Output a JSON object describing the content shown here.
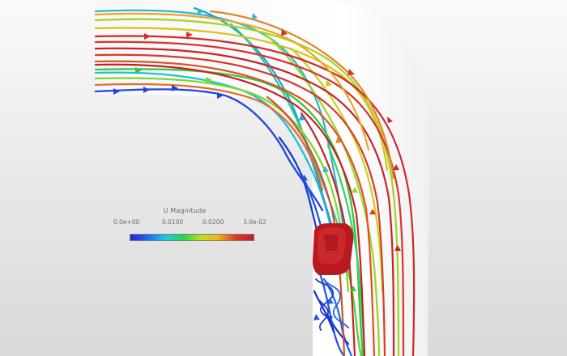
{
  "legend": {
    "title": "U Magnitude",
    "ticks": [
      "0.0e+00",
      "0.0100",
      "0.0200",
      "3.0e-02"
    ],
    "min": 0.0,
    "max": 0.03,
    "gradient": [
      "#2b1fd8",
      "#1f6cf0",
      "#20c9e6",
      "#28d14f",
      "#b8e21a",
      "#f2b21a",
      "#e0392a",
      "#c21d2a"
    ]
  },
  "colors": {
    "background_top": "#fafafa",
    "background_bottom": "#d9d9d9",
    "pipe_wall": "#ffffff",
    "obstacle": "#b9191e",
    "low_velocity": "#1f3fd8",
    "high_velocity": "#c9232a"
  }
}
